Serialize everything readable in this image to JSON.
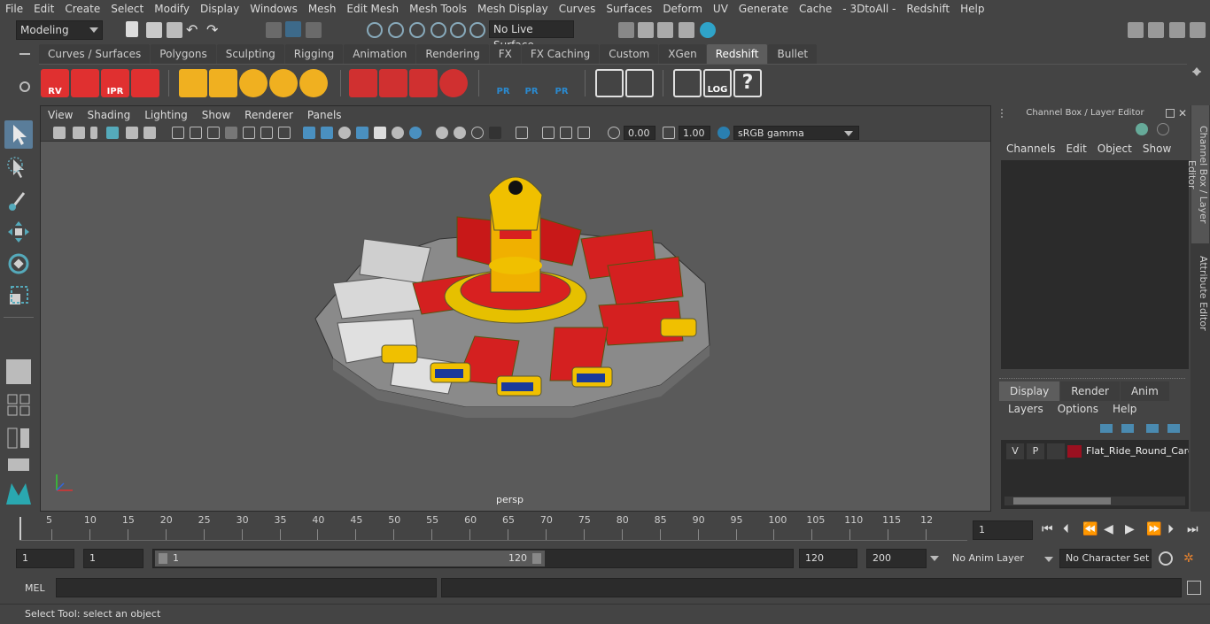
{
  "menubar": [
    "File",
    "Edit",
    "Create",
    "Select",
    "Modify",
    "Display",
    "Windows",
    "Mesh",
    "Edit Mesh",
    "Mesh Tools",
    "Mesh Display",
    "Curves",
    "Surfaces",
    "Deform",
    "UV",
    "Generate",
    "Cache",
    "- 3DtoAll -",
    "Redshift",
    "Help"
  ],
  "statusline": {
    "mode": "Modeling",
    "live_surface": "No Live Surface"
  },
  "shelf_tabs": [
    "Curves / Surfaces",
    "Polygons",
    "Sculpting",
    "Rigging",
    "Animation",
    "Rendering",
    "FX",
    "FX Caching",
    "Custom",
    "XGen",
    "Redshift",
    "Bullet"
  ],
  "shelf_active": "Redshift",
  "shelf_icons": [
    {
      "name": "rv-icon",
      "label": "RV",
      "color": "#e03030"
    },
    {
      "name": "render-cube-icon",
      "label": "",
      "color": "#e03030"
    },
    {
      "name": "ipr-icon",
      "label": "IPR",
      "color": "#e03030"
    },
    {
      "name": "render-settings-icon",
      "label": "",
      "color": "#e03030"
    },
    {
      "name": "rs-proxy-icon",
      "label": "",
      "color": "#f0b020"
    },
    {
      "name": "rs-shelf-icon",
      "label": "",
      "color": "#f0b020"
    },
    {
      "name": "cone-light-icon",
      "label": "",
      "color": "#f0b020"
    },
    {
      "name": "area-light-icon",
      "label": "",
      "color": "#f0b020"
    },
    {
      "name": "dome-light-icon",
      "label": "",
      "color": "#f0b020"
    },
    {
      "name": "volume-icon",
      "label": "",
      "color": "#d03030"
    },
    {
      "name": "hair-icon",
      "label": "",
      "color": "#d03030"
    },
    {
      "name": "shader-icon",
      "label": "",
      "color": "#d03030"
    },
    {
      "name": "material-ball-icon",
      "label": "",
      "color": "#d03030"
    },
    {
      "name": "pr-export-icon",
      "label": "PR",
      "color": "#2a8ad0"
    },
    {
      "name": "pr-import-icon",
      "label": "PR",
      "color": "#2a8ad0"
    },
    {
      "name": "pr-convert-icon",
      "label": "PR",
      "color": "#2a8ad0"
    },
    {
      "name": "bake-icon",
      "label": "",
      "color": "#e0e0e0"
    },
    {
      "name": "bake-set-icon",
      "label": "",
      "color": "#e0e0e0"
    },
    {
      "name": "script-icon",
      "label": "",
      "color": "#e0e0e0"
    },
    {
      "name": "log-icon",
      "label": "LOG",
      "color": "#e0e0e0"
    },
    {
      "name": "help-icon",
      "label": "?",
      "color": "#e0e0e0"
    }
  ],
  "viewport": {
    "menu": [
      "View",
      "Shading",
      "Lighting",
      "Show",
      "Renderer",
      "Panels"
    ],
    "near_value": "0.00",
    "far_value": "1.00",
    "color_space": "sRGB gamma",
    "camera_label": "persp"
  },
  "channel_box": {
    "title": "Channel Box / Layer Editor",
    "menu": [
      "Channels",
      "Edit",
      "Object",
      "Show"
    ],
    "layer_tabs": [
      "Display",
      "Render",
      "Anim"
    ],
    "layer_menu": [
      "Layers",
      "Options",
      "Help"
    ],
    "layer": {
      "v": "V",
      "p": "P",
      "color": "#9a1020",
      "name": "Flat_Ride_Round_Carc"
    }
  },
  "side_tabs": [
    "Channel Box / Layer Editor",
    "Attribute Editor"
  ],
  "timeline": {
    "ticks": [
      "5",
      "10",
      "15",
      "20",
      "25",
      "30",
      "35",
      "40",
      "45",
      "50",
      "55",
      "60",
      "65",
      "70",
      "75",
      "80",
      "85",
      "90",
      "95",
      "100",
      "105",
      "110",
      "115",
      "12"
    ],
    "current_label": "1",
    "current_frame": "1"
  },
  "range": {
    "start": "1",
    "start2": "1",
    "slider_start": "1",
    "slider_end": "120",
    "end": "120",
    "end2": "200",
    "anim_layer": "No Anim Layer",
    "char_set": "No Character Set"
  },
  "cmdline": {
    "label": "MEL"
  },
  "help_line": "Select Tool: select an object"
}
